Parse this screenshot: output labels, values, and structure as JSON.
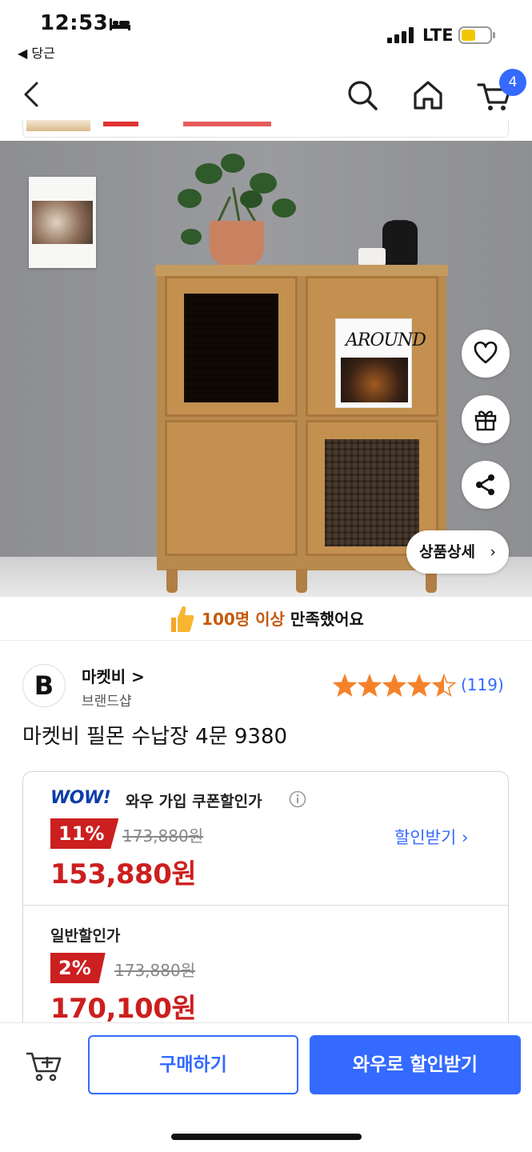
{
  "status_bar": {
    "time": "12:53",
    "back_app": "◀ 당근",
    "network": "LTE"
  },
  "nav": {
    "cart_count": "4"
  },
  "hero": {
    "book_title": "AROUND",
    "detail_button": "상품상세",
    "detail_chevron": "›"
  },
  "satisfaction": {
    "highlight": "100명 이상",
    "rest": " 만족했어요"
  },
  "brand": {
    "logo_letter": "B",
    "name": "마켓비 >",
    "sub": "브랜드샵"
  },
  "rating": {
    "stars": 4.5,
    "count": "(119)"
  },
  "product": {
    "title": "마켓비 필몬 수납장 4문 9380"
  },
  "wow_price": {
    "logo": "WOW!",
    "label": "와우 가입 쿠폰할인가",
    "discount": "11%",
    "original": "173,880원",
    "price": "153,880원",
    "coupon_link": "할인받기 ›"
  },
  "normal_price": {
    "label": "일반할인가",
    "discount": "2%",
    "original": "173,880원",
    "price": "170,100원"
  },
  "bottom_bar": {
    "buy": "구매하기",
    "wow_buy": "와우로 할인받기"
  },
  "colors": {
    "accent": "#346aff",
    "sale": "#cc1f1f",
    "star": "#f5822a",
    "wow": "#0c3ea8"
  },
  "icons": [
    "bed-icon",
    "signal-icon",
    "battery-icon",
    "back-icon",
    "search-icon",
    "home-icon",
    "cart-icon",
    "heart-icon",
    "gift-icon",
    "share-icon",
    "thumbs-up-icon",
    "star-icon",
    "info-icon",
    "add-cart-icon"
  ]
}
